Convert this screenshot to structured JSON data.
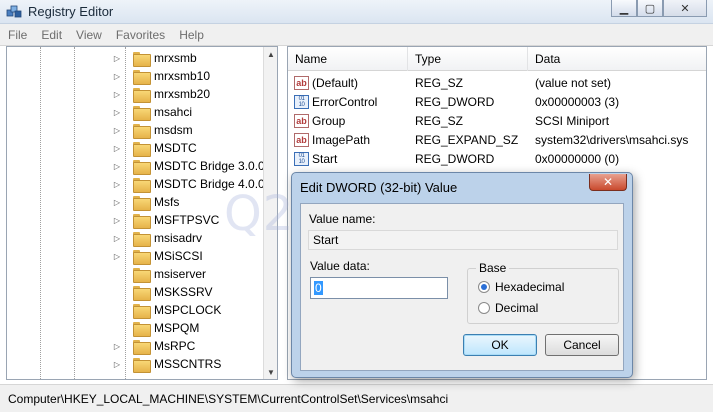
{
  "window": {
    "title": "Registry Editor"
  },
  "window_buttons": {
    "minimize": "▁",
    "maximize": "▢",
    "close": "✕"
  },
  "menu": [
    "File",
    "Edit",
    "View",
    "Favorites",
    "Help"
  ],
  "tree": {
    "items": [
      "mrxsmb",
      "mrxsmb10",
      "mrxsmb20",
      "msahci",
      "msdsm",
      "MSDTC",
      "MSDTC Bridge 3.0.0.0",
      "MSDTC Bridge 4.0.0.0",
      "Msfs",
      "MSFTPSVC",
      "msisadrv",
      "MSiSCSI",
      "msiserver",
      "MSKSSRV",
      "MSPCLOCK",
      "MSPQM",
      "MsRPC",
      "MSSCNTRS"
    ],
    "expandable": [
      true,
      true,
      true,
      true,
      true,
      true,
      true,
      true,
      true,
      true,
      true,
      true,
      false,
      false,
      false,
      false,
      true,
      true
    ]
  },
  "list": {
    "columns": [
      "Name",
      "Type",
      "Data"
    ],
    "rows": [
      {
        "icon": "ab",
        "name": "(Default)",
        "type": "REG_SZ",
        "data": "(value not set)"
      },
      {
        "icon": "bin",
        "name": "ErrorControl",
        "type": "REG_DWORD",
        "data": "0x00000003 (3)"
      },
      {
        "icon": "ab",
        "name": "Group",
        "type": "REG_SZ",
        "data": "SCSI Miniport"
      },
      {
        "icon": "ab",
        "name": "ImagePath",
        "type": "REG_EXPAND_SZ",
        "data": "system32\\drivers\\msahci.sys"
      },
      {
        "icon": "bin",
        "name": "Start",
        "type": "REG_DWORD",
        "data": "0x00000000 (0)"
      }
    ]
  },
  "status": {
    "path": "Computer\\HKEY_LOCAL_MACHINE\\SYSTEM\\CurrentControlSet\\Services\\msahci"
  },
  "watermark": "Q2W3.RU",
  "dialog": {
    "title": "Edit DWORD (32-bit) Value",
    "close": "✕",
    "value_name_label": "Value name:",
    "value_name": "Start",
    "value_data_label": "Value data:",
    "value_data": "0",
    "base_label": "Base",
    "hex_label": "Hexadecimal",
    "dec_label": "Decimal",
    "selected_base": "Hexadecimal",
    "ok": "OK",
    "cancel": "Cancel"
  }
}
